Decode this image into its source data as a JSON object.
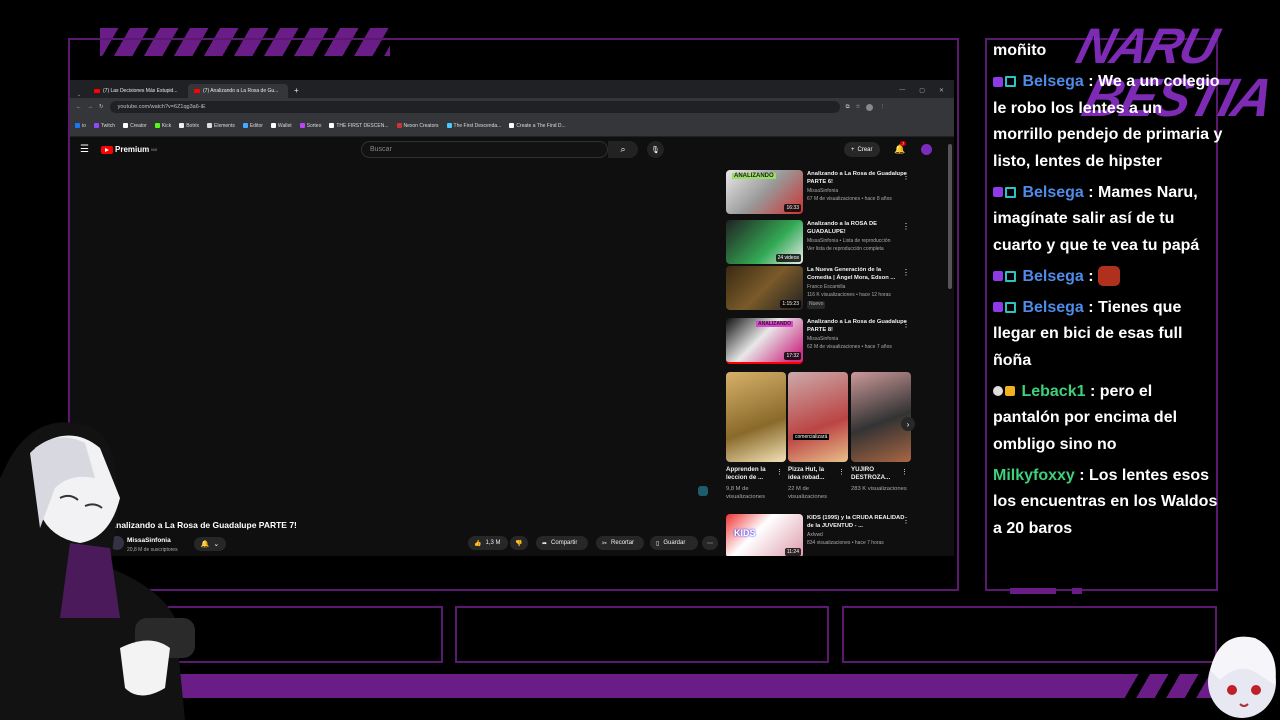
{
  "overlay": {
    "logo_text": "NARU BESTIA",
    "colors": {
      "accent": "#6a1d86",
      "frame": "#5b1a70"
    }
  },
  "browser": {
    "tabs": [
      {
        "label": "(7) Las Decisiones Más Estupid..."
      },
      {
        "label": "(7) Analizando a La Rosa de Gu..."
      }
    ],
    "url": "youtube.com/watch?v=6Z1qg3a6-iE",
    "bookmarks": [
      "io",
      "Twitch",
      "Creator",
      "Kick",
      "Botrix",
      "Elements",
      "Editor",
      "Wallet",
      "Sorteo",
      "THE FIRST DESCEN...",
      "Nexon Creators",
      "The First Descenda...",
      "Create a The Find D..."
    ]
  },
  "youtube": {
    "logo_label": "Premium",
    "country": "MX",
    "search_placeholder": "Buscar",
    "create_label": "Crear",
    "notif_count": "7",
    "video_title": "Analizando a La Rosa de Guadalupe PARTE 7!",
    "channel": {
      "name": "MissaSinfonia",
      "subscribers": "20,8 M de suscriptores"
    },
    "actions": {
      "likes": "1,3 M",
      "share": "Compartir",
      "clip": "Recortar",
      "save": "Guardar"
    },
    "recommendations": [
      {
        "title": "Analizando a La Rosa de Guadalupe PARTE 6!",
        "channel": "MissaSinfonia",
        "meta": "67 M de visualizaciones • hace 8 años",
        "duration": "16:33",
        "thumb_text": "ANALIZANDO"
      },
      {
        "title": "Analizando a la ROSA DE GUADALUPE!",
        "channel": "MissaSinfonia",
        "meta": "Lista de reproducción",
        "meta2": "Ver lista de reproducción completa",
        "duration": "24 videos"
      },
      {
        "title": "La Nueva Generación de la Comedia | Ángel Mora, Edson ...",
        "channel": "Franco Escamilla",
        "meta": "116 K visualizaciones • hace 12 horas",
        "badge": "Nuevo",
        "duration": "1:15:23"
      },
      {
        "title": "Analizando a La Rosa de Guadalupe PARTE 8!",
        "channel": "MissaSinfonia",
        "meta": "62 M de visualizaciones • hace 7 años",
        "duration": "17:32",
        "thumb_text": "ANALIZANDO"
      }
    ],
    "shorts": [
      {
        "title": "Apprenden la leccion de ...",
        "views": "9,8 M de visualizaciones"
      },
      {
        "title": "Pizza Hut, la idea robad...",
        "views": "22 M de visualizaciones",
        "caption": "comercializará"
      },
      {
        "title": "YUJIRO DESTROZA...",
        "views": "283 K visualizaciones"
      }
    ],
    "last_rec": {
      "title": "KIDS (1995) y la CRUDA REALIDAD de la JUVENTUD - ...",
      "channel": "Axlvwd",
      "meta": "834 visualizaciones • hace 7 horas",
      "duration": "11:24",
      "thumb_text": "KIDS"
    }
  },
  "chat": {
    "messages": [
      {
        "user": "",
        "color": "",
        "text": "moñito"
      },
      {
        "user": "Belsega",
        "color": "#4f8be8",
        "badges": 2,
        "text": "We a un colegio le robo los lentes a un morrillo pendejo de primaria y listo, lentes de hipster"
      },
      {
        "user": "Belsega",
        "color": "#4f8be8",
        "badges": 2,
        "text": "Mames Naru, imagínate salir así de tu cuarto y que te vea tu papá"
      },
      {
        "user": "Belsega",
        "color": "#4f8be8",
        "badges": 2,
        "text": "",
        "emote": "angry-face"
      },
      {
        "user": "Belsega",
        "color": "#4f8be8",
        "badges": 2,
        "text": "Tienes que llegar en bici de esas full ñoña"
      },
      {
        "user": "Leback1",
        "color": "#3ed07a",
        "badges": 2,
        "text": "pero el pantalón por encima del ombligo sino no"
      },
      {
        "user": "Milkyfoxxy",
        "color": "#3ed07a",
        "badges": 0,
        "text": "Los lentes esos los encuentras en los Waldos a 20 baros"
      }
    ]
  }
}
